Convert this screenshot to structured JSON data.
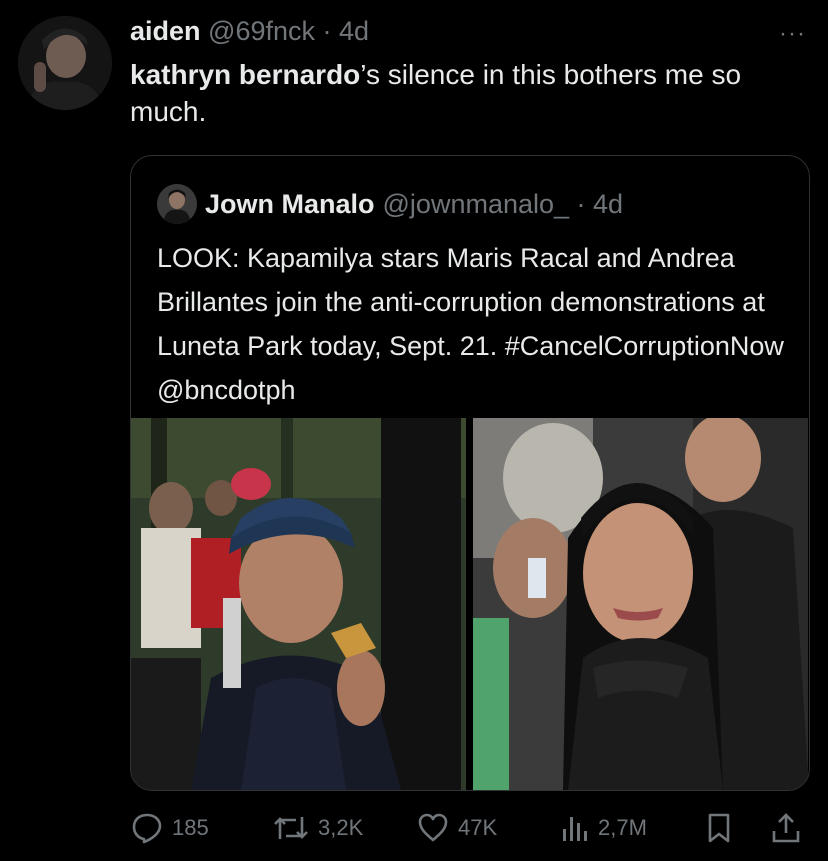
{
  "post": {
    "display_name": "aiden",
    "handle": "@69fnck",
    "separator": " · ",
    "time": "4d",
    "text_bold": "kathryn bernardo",
    "text_rest": "’s silence in this bothers me so much.",
    "more_label": "···"
  },
  "quote": {
    "display_name": "Jown Manalo",
    "handle": "@jownmanalo_",
    "separator": " · ",
    "time": "4d",
    "text": "LOOK: Kapamilya stars Maris Racal and Andrea Brillantes join the anti-corruption demonstrations at Luneta Park today, Sept. 21. #CancelCorruptionNow @bncdotph"
  },
  "actions": {
    "replies": "185",
    "reposts": "3,2K",
    "likes": "47K",
    "views": "2,7M"
  },
  "icons": {
    "reply": "reply-icon",
    "repost": "repost-icon",
    "like": "heart-icon",
    "views": "views-icon",
    "bookmark": "bookmark-icon",
    "share": "share-icon"
  }
}
